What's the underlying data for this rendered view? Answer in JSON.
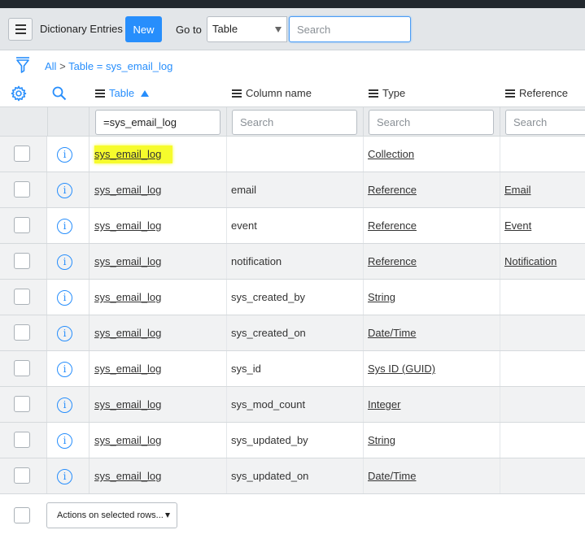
{
  "header": {
    "title": "Dictionary Entries",
    "new_label": "New",
    "goto_label": "Go to",
    "goto_select_value": "Table",
    "search_placeholder": "Search"
  },
  "breadcrumb": {
    "all": "All",
    "separator": ">",
    "condition": "Table = sys_email_log"
  },
  "columns": {
    "table": "Table",
    "column_name": "Column name",
    "type": "Type",
    "reference": "Reference"
  },
  "filters": {
    "table_value": "=sys_email_log",
    "column_name_placeholder": "Search",
    "type_placeholder": "Search",
    "reference_placeholder": "Search"
  },
  "rows": [
    {
      "table": "sys_email_log",
      "column": "",
      "type": "Collection",
      "reference": ""
    },
    {
      "table": "sys_email_log",
      "column": "email",
      "type": "Reference",
      "reference": "Email"
    },
    {
      "table": "sys_email_log",
      "column": "event",
      "type": "Reference",
      "reference": "Event"
    },
    {
      "table": "sys_email_log",
      "column": "notification",
      "type": "Reference",
      "reference": "Notification"
    },
    {
      "table": "sys_email_log",
      "column": "sys_created_by",
      "type": "String",
      "reference": ""
    },
    {
      "table": "sys_email_log",
      "column": "sys_created_on",
      "type": "Date/Time",
      "reference": ""
    },
    {
      "table": "sys_email_log",
      "column": "sys_id",
      "type": "Sys ID (GUID)",
      "reference": ""
    },
    {
      "table": "sys_email_log",
      "column": "sys_mod_count",
      "type": "Integer",
      "reference": ""
    },
    {
      "table": "sys_email_log",
      "column": "sys_updated_by",
      "type": "String",
      "reference": ""
    },
    {
      "table": "sys_email_log",
      "column": "sys_updated_on",
      "type": "Date/Time",
      "reference": ""
    }
  ],
  "footer": {
    "actions_label": "Actions on selected rows..."
  },
  "colors": {
    "accent": "#278efc",
    "highlight": "#f6fb2c",
    "header_bg": "#e3e6e9"
  },
  "info_glyph": "i"
}
